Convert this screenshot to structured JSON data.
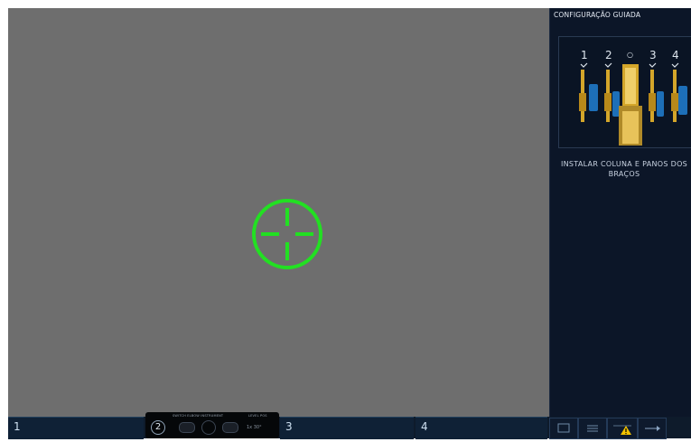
{
  "viewer": {
    "reticle_color": "#22e022"
  },
  "panel": {
    "title": "CONFIGURAÇÃO GUIADA",
    "arms": [
      {
        "label": "1"
      },
      {
        "label": "2"
      },
      {
        "label": "○"
      },
      {
        "label": "3"
      },
      {
        "label": "4"
      }
    ],
    "instruction": "INSTALAR COLUNA E PANOS DOS BRAÇOS"
  },
  "bottom_bar": {
    "arm1": "1",
    "arm2": "2",
    "arm3": "3",
    "arm4": "4",
    "dock_label_left": "SWITCH   ELBOW   INSTRUMENT",
    "dock_label_right": "LEVEL   POS",
    "dock_value": "1x  30°"
  },
  "colors": {
    "gold": "#d4a62a",
    "accent_blue": "#1d6fb8",
    "warning": "#f2c200"
  }
}
